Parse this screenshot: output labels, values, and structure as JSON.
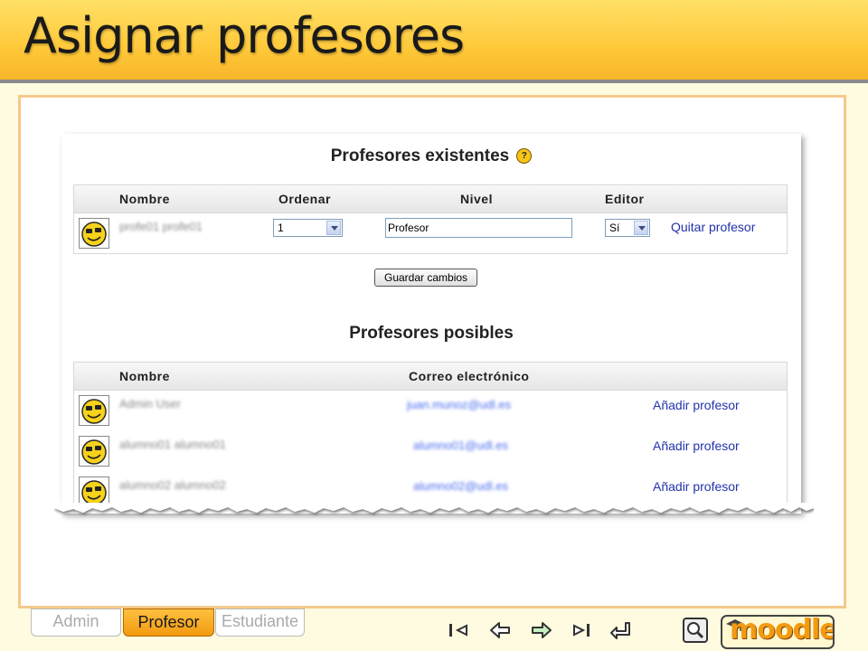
{
  "slide": {
    "title": "Asignar profesores"
  },
  "existing": {
    "title": "Profesores existentes",
    "help_glyph": "?",
    "columns": {
      "name": "Nombre",
      "order": "Ordenar",
      "level": "Nivel",
      "editor": "Editor"
    },
    "rows": [
      {
        "name": "profe01 profe01",
        "order": "1",
        "level": "Profesor",
        "editor": "Sí",
        "action": "Quitar profesor"
      }
    ],
    "save_button": "Guardar cambios"
  },
  "possible": {
    "title": "Profesores posibles",
    "columns": {
      "name": "Nombre",
      "email": "Correo electrónico"
    },
    "rows": [
      {
        "name": "Admin User",
        "email": "juan.munoz@udl.es",
        "action": "Añadir profesor"
      },
      {
        "name": "alumno01 alumno01",
        "email": "alumno01@udl.es",
        "action": "Añadir profesor"
      },
      {
        "name": "alumno02 alumno02",
        "email": "alumno02@udl.es",
        "action": "Añadir profesor"
      }
    ]
  },
  "tabs": [
    {
      "label": "Admin",
      "active": false
    },
    {
      "label": "Profesor",
      "active": true
    },
    {
      "label": "Estudiante",
      "active": false
    }
  ],
  "logo": {
    "text": "moodle"
  },
  "icons": {
    "nav": [
      "first-slide-icon",
      "prev-slide-icon",
      "next-slide-icon",
      "last-slide-icon",
      "return-icon"
    ],
    "search": "search-icon"
  },
  "colors": {
    "accent": "#f7b52a",
    "link": "#2233aa",
    "frame": "#f5c98a"
  }
}
